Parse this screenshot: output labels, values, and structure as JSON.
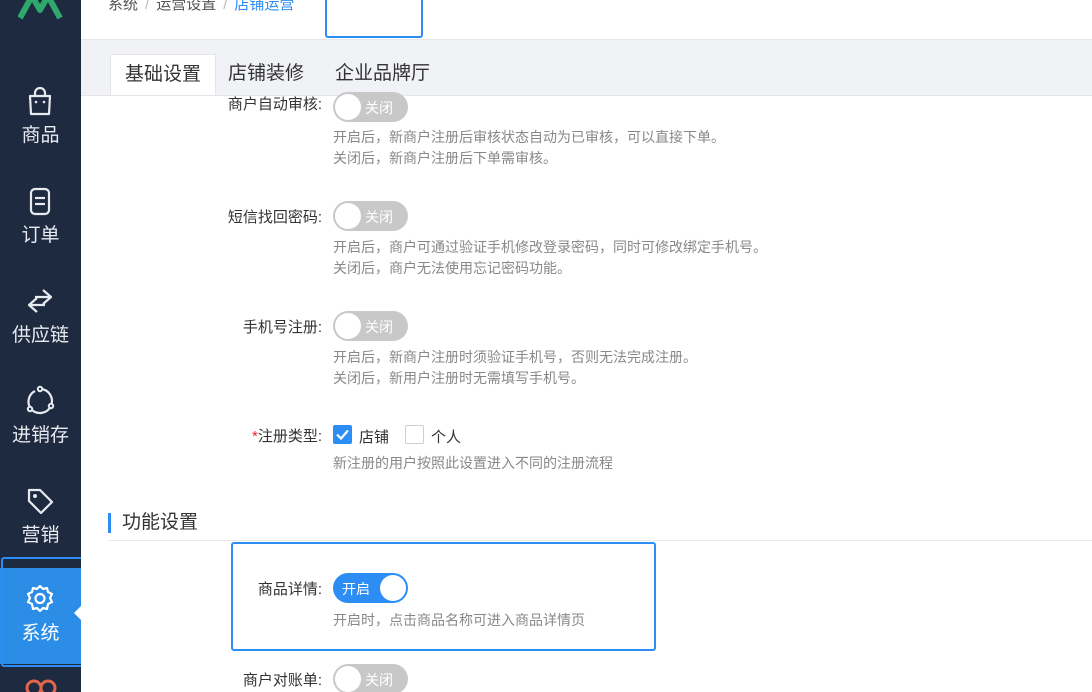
{
  "breadcrumb": {
    "items": [
      "系统",
      "运营设置"
    ],
    "current": "店铺运营"
  },
  "sidebar": {
    "items": [
      {
        "label": "商品",
        "icon": "shopping-bag-icon"
      },
      {
        "label": "订单",
        "icon": "order-icon"
      },
      {
        "label": "供应链",
        "icon": "exchange-arrows-icon"
      },
      {
        "label": "进销存",
        "icon": "inventory-icon"
      },
      {
        "label": "营销",
        "icon": "tag-icon"
      },
      {
        "label": "系统",
        "icon": "gear-icon",
        "active": true
      }
    ],
    "accent": "#2c8df4",
    "background": "#1e2a3f"
  },
  "tabs": [
    {
      "label": "基础设置",
      "active": true
    },
    {
      "label": "店铺装修"
    },
    {
      "label": "企业品牌厅"
    }
  ],
  "settings": {
    "auto_audit": {
      "label": "商户自动审核:",
      "state": "关闭",
      "desc1": "开启后，新商户注册后审核状态自动为已审核，可以直接下单。",
      "desc2": "关闭后，新商户注册后下单需审核。"
    },
    "sms_recover": {
      "label": "短信找回密码:",
      "state": "关闭",
      "desc1": "开启后，商户可通过验证手机修改登录密码，同时可修改绑定手机号。",
      "desc2": "关闭后，商户无法使用忘记密码功能。"
    },
    "phone_register": {
      "label": "手机号注册:",
      "state": "关闭",
      "desc1": "开启后，新商户注册时须验证手机号，否则无法完成注册。",
      "desc2": "关闭后，新用户注册时无需填写手机号。"
    },
    "register_type": {
      "required_mark": "*",
      "label": "注册类型:",
      "options": [
        {
          "label": "店铺",
          "checked": true
        },
        {
          "label": "个人",
          "checked": false
        }
      ],
      "desc": "新注册的用户按照此设置进入不同的注册流程"
    }
  },
  "function_section": {
    "title": "功能设置",
    "product_detail": {
      "label": "商品详情:",
      "state": "开启",
      "desc": "开启时，点击商品名称可进入商品详情页"
    },
    "merchant_statement": {
      "label": "商户对账单:",
      "state": "关闭"
    }
  }
}
